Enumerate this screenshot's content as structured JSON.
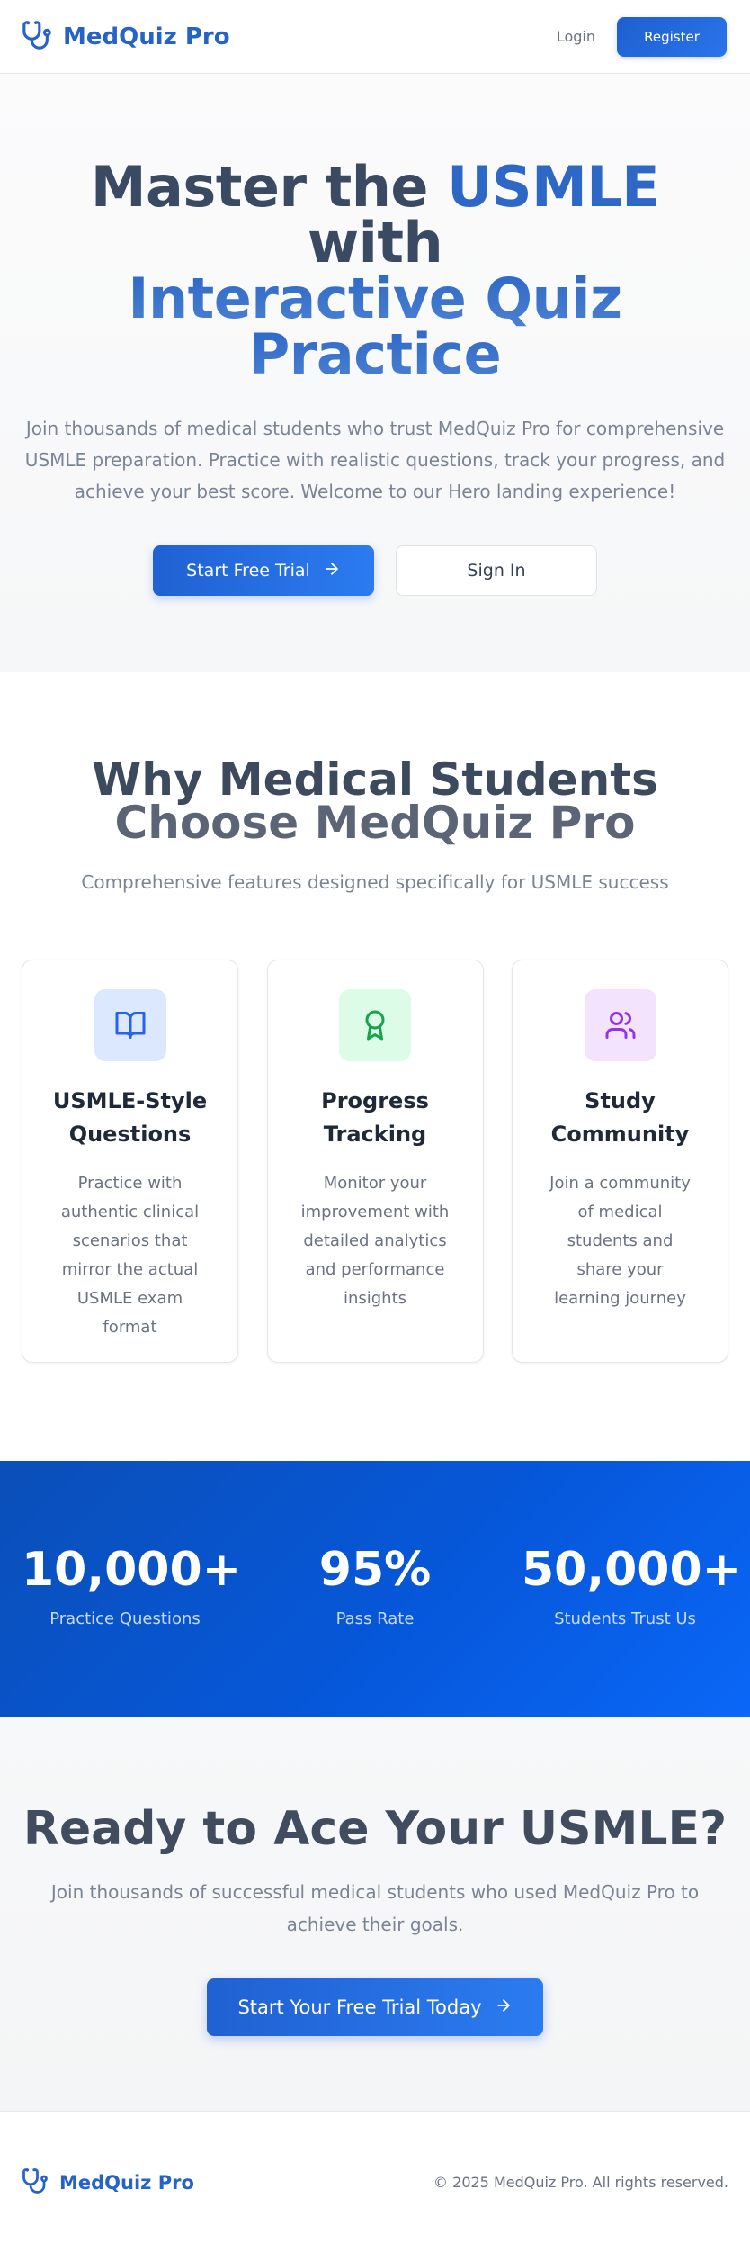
{
  "header": {
    "brand": "MedQuiz Pro",
    "login": "Login",
    "register": "Register"
  },
  "hero": {
    "title_part1": "Master the",
    "title_part2": "USMLE",
    "title_part3": "with",
    "title_part4": "Interactive Quiz",
    "title_part5": "Practice",
    "subtitle": "Join thousands of medical students who trust MedQuiz Pro for comprehensive USMLE preparation. Practice with realistic questions, track your progress, and achieve your best score. Welcome to our Hero landing experience!",
    "primary_button": "Start Free Trial",
    "secondary_button": "Sign In"
  },
  "features": {
    "title_line1": "Why Medical Students",
    "title_line2": "Choose MedQuiz Pro",
    "subtitle": "Comprehensive features designed specifically for USMLE success",
    "cards": [
      {
        "icon": "book-open-icon",
        "title": "USMLE-Style Questions",
        "description": "Practice with authentic clinical scenarios that mirror the actual USMLE exam format"
      },
      {
        "icon": "award-icon",
        "title": "Progress Tracking",
        "description": "Monitor your improvement with detailed analytics and performance insights"
      },
      {
        "icon": "users-icon",
        "title": "Study Community",
        "description": "Join a community of medical students and share your learning journey"
      }
    ]
  },
  "stats": [
    {
      "value": "10,000+",
      "label": "Practice Questions"
    },
    {
      "value": "95%",
      "label": "Pass Rate"
    },
    {
      "value": "50,000+",
      "label": "Students Trust Us"
    }
  ],
  "cta": {
    "title": "Ready to Ace Your USMLE?",
    "subtitle": "Join thousands of successful medical students who used MedQuiz Pro to achieve their goals.",
    "button": "Start Your Free Trial Today"
  },
  "footer": {
    "brand": "MedQuiz Pro",
    "copyright": "© 2025 MedQuiz Pro. All rights reserved."
  },
  "colors": {
    "brand_blue": "#2563c9",
    "stats_background": "#0657d9",
    "card_icon_blue_bg": "#dbe8fd",
    "card_icon_green_bg": "#dcfce7",
    "card_icon_purple_bg": "#f3e3fd"
  }
}
